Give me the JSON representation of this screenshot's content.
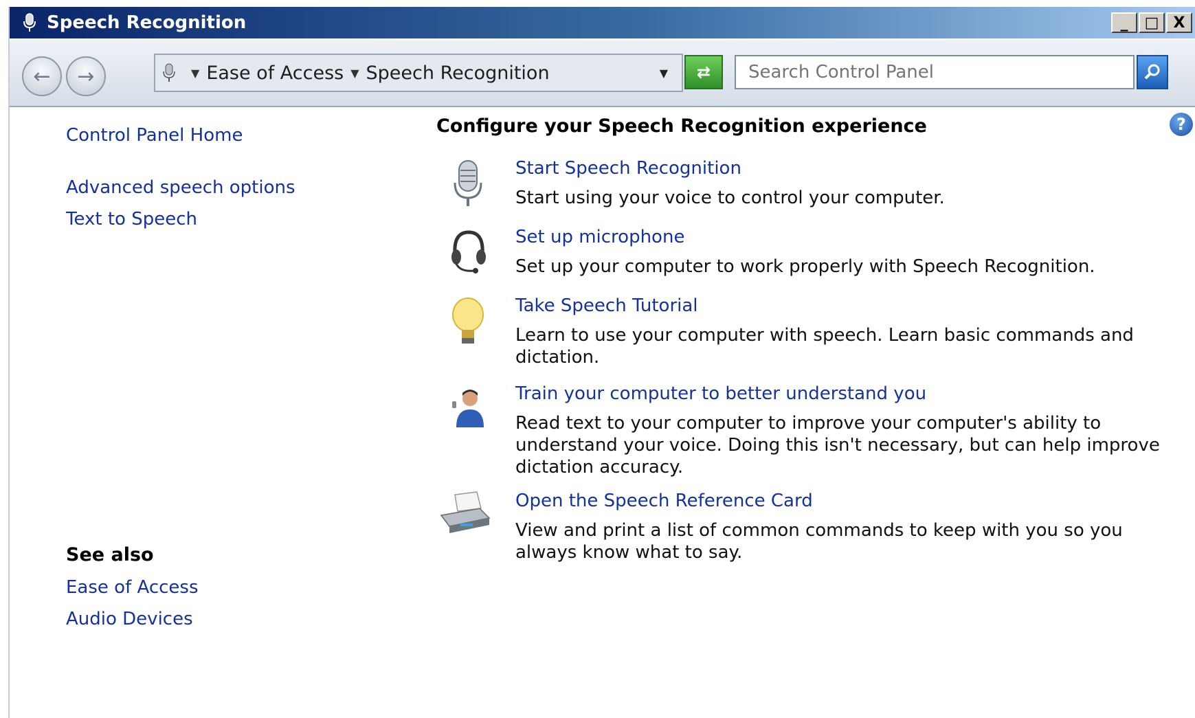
{
  "window": {
    "title": "Speech Recognition",
    "caption_buttons": [
      "_",
      "□",
      "X"
    ]
  },
  "navbar": {
    "breadcrumb": [
      "Ease of Access",
      "Speech Recognition"
    ],
    "search_placeholder": "Search Control Panel"
  },
  "sidebar": {
    "links": [
      "Control Panel Home",
      "Advanced speech options",
      "Text to Speech"
    ],
    "see_also_title": "See also",
    "see_also": [
      "Ease of Access",
      "Audio Devices"
    ]
  },
  "main": {
    "heading": "Configure your Speech Recognition experience",
    "tasks": [
      {
        "title": "Start Speech Recognition",
        "desc": "Start using your voice to control your computer.",
        "icon": "microphone-icon"
      },
      {
        "title": "Set up microphone",
        "desc": "Set up your computer to work properly with Speech Recognition.",
        "icon": "headset-icon"
      },
      {
        "title": "Take Speech Tutorial",
        "desc": "Learn to use your computer with speech.  Learn basic commands and dictation.",
        "icon": "lightbulb-icon"
      },
      {
        "title": "Train your computer to better understand you",
        "desc": "Read text to your computer to improve your computer's ability to understand your voice.  Doing this isn't necessary, but can help improve dictation accuracy.",
        "icon": "person-icon"
      },
      {
        "title": "Open the Speech Reference Card",
        "desc": "View and print a list of common commands to keep with you so you always know what to say.",
        "icon": "printer-icon"
      }
    ]
  }
}
